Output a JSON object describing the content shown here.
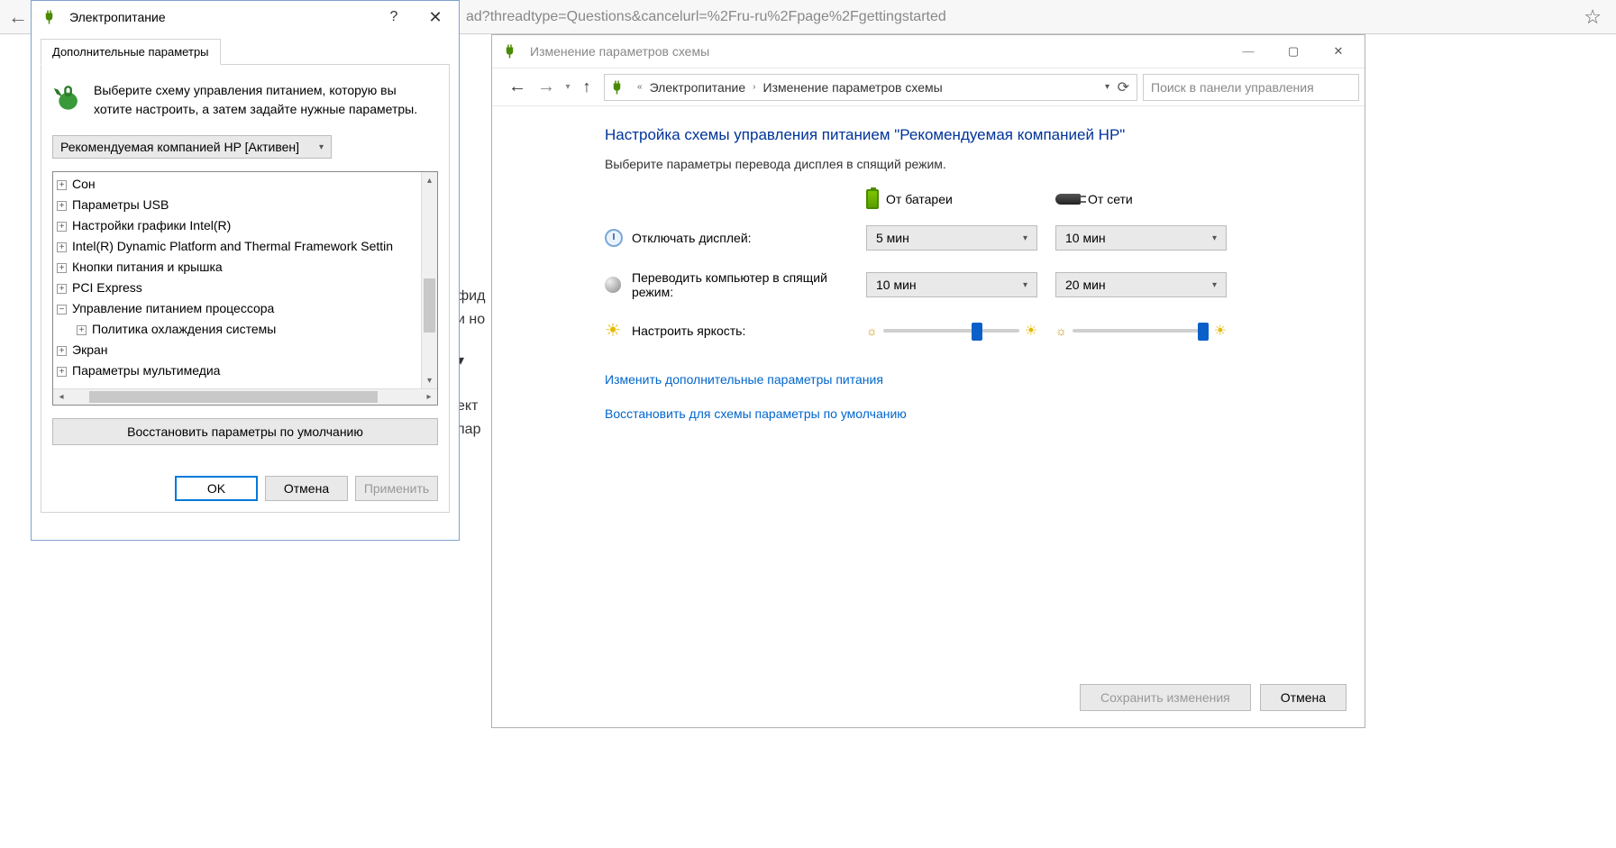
{
  "browser": {
    "url_fragment": "ad?threadtype=Questions&cancelurl=%2Fru-ru%2Fpage%2Fgettingstarted"
  },
  "partials": {
    "t1": "фид",
    "t2": "и но",
    "t3": "ект",
    "t4": "пар"
  },
  "editPlan": {
    "title": "Изменение параметров схемы",
    "breadcrumb": {
      "root": "Электропитание",
      "current": "Изменение параметров схемы"
    },
    "search_placeholder": "Поиск в панели управления",
    "heading": "Настройка схемы управления питанием \"Рекомендуемая компанией HP\"",
    "subheading": "Выберите параметры перевода дисплея в спящий режим.",
    "col_battery": "От батареи",
    "col_ac": "От сети",
    "row_display": "Отключать дисплей:",
    "row_sleep": "Переводить компьютер в спящий режим:",
    "row_brightness": "Настроить яркость:",
    "values": {
      "display_battery": "5 мин",
      "display_ac": "10 мин",
      "sleep_battery": "10 мин",
      "sleep_ac": "20 мин"
    },
    "brightness": {
      "battery_pct": 65,
      "ac_pct": 95
    },
    "link_advanced": "Изменить дополнительные параметры питания",
    "link_defaults": "Восстановить для схемы параметры по умолчанию",
    "btn_save": "Сохранить изменения",
    "btn_cancel": "Отмена"
  },
  "powerDialog": {
    "title": "Электропитание",
    "tab": "Дополнительные параметры",
    "intro": "Выберите схему управления питанием, которую вы хотите настроить, а затем задайте нужные параметры.",
    "plan_selector": "Рекомендуемая компанией HP [Активен]",
    "tree": [
      {
        "exp": "+",
        "label": "Сон",
        "indent": 0
      },
      {
        "exp": "+",
        "label": "Параметры USB",
        "indent": 0
      },
      {
        "exp": "+",
        "label": "Настройки графики Intel(R)",
        "indent": 0
      },
      {
        "exp": "+",
        "label": "Intel(R) Dynamic Platform and Thermal Framework Settin",
        "indent": 0
      },
      {
        "exp": "+",
        "label": "Кнопки питания и крышка",
        "indent": 0
      },
      {
        "exp": "+",
        "label": "PCI Express",
        "indent": 0
      },
      {
        "exp": "−",
        "label": "Управление питанием процессора",
        "indent": 0
      },
      {
        "exp": "+",
        "label": "Политика охлаждения системы",
        "indent": 1
      },
      {
        "exp": "+",
        "label": "Экран",
        "indent": 0
      },
      {
        "exp": "+",
        "label": "Параметры мультимедиа",
        "indent": 0
      }
    ],
    "defaults_btn": "Восстановить параметры по умолчанию",
    "btn_ok": "OK",
    "btn_cancel": "Отмена",
    "btn_apply": "Применить"
  }
}
